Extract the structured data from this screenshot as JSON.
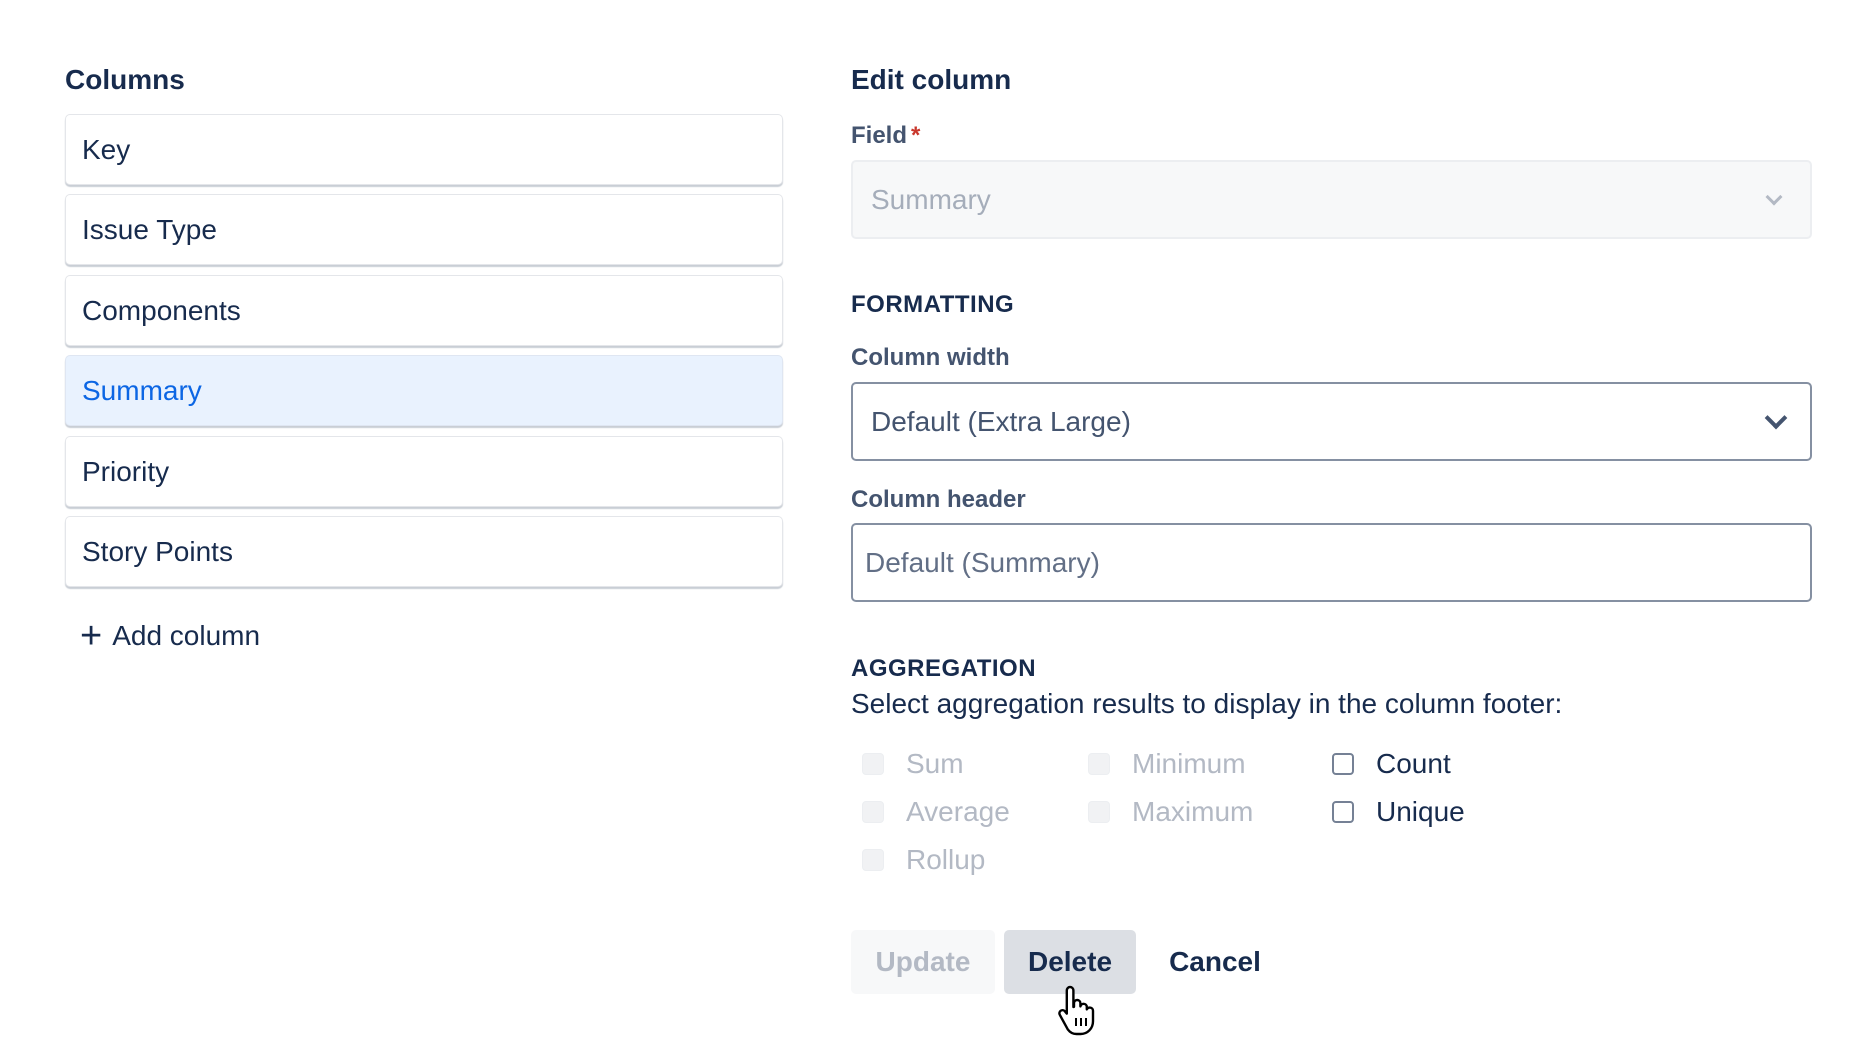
{
  "columns_panel": {
    "title": "Columns",
    "items": [
      {
        "label": "Key",
        "selected": false
      },
      {
        "label": "Issue Type",
        "selected": false
      },
      {
        "label": "Components",
        "selected": false
      },
      {
        "label": "Summary",
        "selected": true
      },
      {
        "label": "Priority",
        "selected": false
      },
      {
        "label": "Story Points",
        "selected": false
      }
    ],
    "add_column": {
      "icon": "plus-icon",
      "label": "Add column"
    }
  },
  "edit_panel": {
    "title": "Edit column",
    "field": {
      "label": "Field",
      "required_marker": "*",
      "value": "Summary",
      "disabled": true,
      "icon": "chevron-down-icon"
    },
    "formatting": {
      "section_title": "FORMATTING",
      "column_width": {
        "label": "Column width",
        "value": "Default (Extra Large)",
        "icon": "chevron-down-icon"
      },
      "column_header": {
        "label": "Column header",
        "value": "",
        "placeholder": "Default (Summary)"
      }
    },
    "aggregation": {
      "section_title": "AGGREGATION",
      "description": "Select aggregation results to display in the column footer:",
      "options": [
        {
          "label": "Sum",
          "checked": false,
          "disabled": true
        },
        {
          "label": "Average",
          "checked": false,
          "disabled": true
        },
        {
          "label": "Rollup",
          "checked": false,
          "disabled": true
        },
        {
          "label": "Minimum",
          "checked": false,
          "disabled": true
        },
        {
          "label": "Maximum",
          "checked": false,
          "disabled": true
        },
        {
          "label": "Count",
          "checked": false,
          "disabled": false
        },
        {
          "label": "Unique",
          "checked": false,
          "disabled": false
        }
      ]
    },
    "buttons": {
      "update": {
        "label": "Update",
        "disabled": true
      },
      "delete": {
        "label": "Delete",
        "hovered": true
      },
      "cancel": {
        "label": "Cancel"
      }
    }
  },
  "colors": {
    "text_primary": "#172b4d",
    "selected_bg": "#e9f2fe",
    "selected_text": "#0c66e4",
    "required": "#c9372c",
    "disabled_text": "#b3b9c4"
  }
}
